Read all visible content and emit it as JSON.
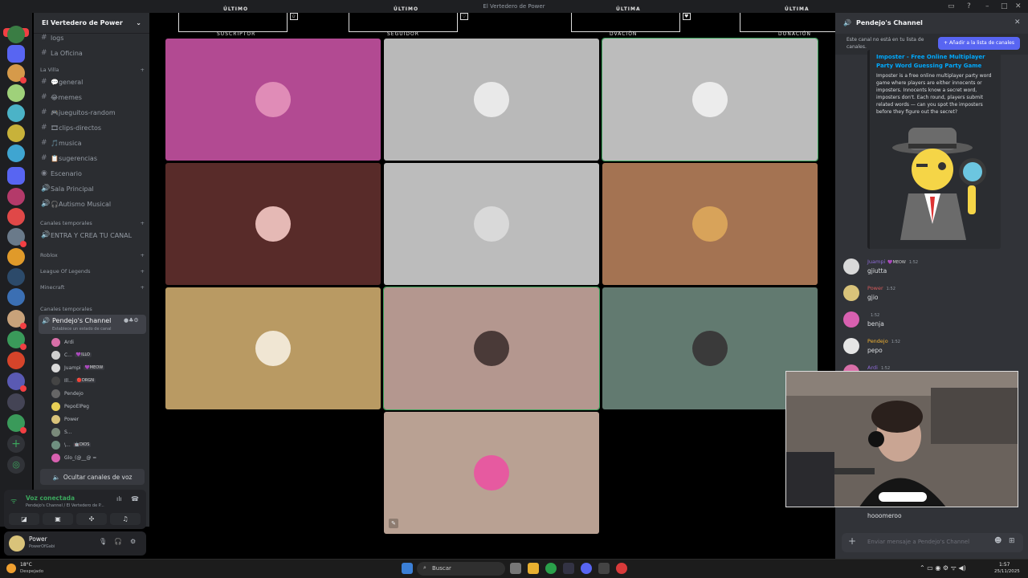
{
  "window": {
    "title": "El Vertedero de Power"
  },
  "rail": {
    "new_badge": "NUEVO"
  },
  "server": {
    "name": "El Vertedero de Power"
  },
  "channels_top": [
    {
      "label": "logs",
      "type": "text"
    },
    {
      "label": "La Oficina",
      "type": "text"
    }
  ],
  "category_villa": "La Villa",
  "channels_villa": [
    {
      "label": "💬general",
      "type": "text"
    },
    {
      "label": "😂memes",
      "type": "text"
    },
    {
      "label": "🎮jueguitos-random",
      "type": "text"
    },
    {
      "label": "🎞clips-directos",
      "type": "text"
    },
    {
      "label": "🎵musica",
      "type": "text"
    },
    {
      "label": "📋sugerencias",
      "type": "text"
    },
    {
      "label": "Escenario",
      "type": "stage"
    },
    {
      "label": "Sala Principal",
      "type": "voice"
    },
    {
      "label": "🎧Autismo Musical",
      "type": "voice"
    }
  ],
  "category_temp": "Canales temporales",
  "channel_create": "ENTRA Y CREA TU CANAL",
  "categories_collapsed": [
    "Roblox",
    "League Of Legends",
    "Minecraft"
  ],
  "category_temp2": "Canales temporales",
  "active_channel": {
    "label": "Pendejo's Channel",
    "status": "Establece un estado de canal"
  },
  "voice_users": [
    {
      "name": "Ardi",
      "tag": "",
      "color": "#d86fa8"
    },
    {
      "name": "C...",
      "tag": "💜ILLO",
      "color": "#cfcfcf"
    },
    {
      "name": "Juampi",
      "tag": "💜MEOW",
      "color": "#d9d9d9"
    },
    {
      "name": "Ill...",
      "tag": "🔴DRGN",
      "color": "#444"
    },
    {
      "name": "Pendejo",
      "tag": "",
      "color": "#666"
    },
    {
      "name": "PepoElPeg",
      "tag": "",
      "color": "#e8cf55"
    },
    {
      "name": "Power",
      "tag": "",
      "color": "#d9c37a"
    },
    {
      "name": "S...",
      "tag": "",
      "color": "#7a8a7a"
    },
    {
      "name": "\\...",
      "tag": "🤖DIOS",
      "color": "#6f8f80"
    },
    {
      "name": "Glo_(@__@ =",
      "tag": "",
      "color": "#d860b0"
    }
  ],
  "hide_voice_label": "Ocultar canales de voz",
  "voice_status": {
    "title": "Voz conectada",
    "subtitle": "Pendejo's Channel / El Vertedero de P..."
  },
  "user": {
    "name": "Power",
    "status": "PowerOfGabi"
  },
  "alerts": [
    {
      "title": "ÚLTIMO",
      "label": "SUSCRIPTOR",
      "icon": "✩"
    },
    {
      "title": "ÚLTIMO",
      "label": "SEGUIDOR",
      "icon": "♡"
    },
    {
      "title": "ÚLTIMA",
      "label": "DVACIÓN",
      "icon": "♥"
    },
    {
      "title": "ÚLTIMA",
      "label": "DONACIÓN",
      "icon": "$"
    }
  ],
  "tiles": [
    {
      "name": "tile-1",
      "bg": "#b24a92",
      "face": "#e08cb7"
    },
    {
      "name": "tile-2",
      "bg": "#b9b9b9",
      "face": "#e9e9e9"
    },
    {
      "name": "tile-3",
      "bg": "#bcbcbc",
      "face": "#ececec"
    },
    {
      "name": "tile-4",
      "bg": "#582b29",
      "face": "#e5b9b5"
    },
    {
      "name": "tile-5",
      "bg": "#bcbcbc",
      "face": "#d9d9d9"
    },
    {
      "name": "tile-6",
      "bg": "#a47352",
      "face": "#d8a35a"
    },
    {
      "name": "tile-7",
      "bg": "#b99a63",
      "face": "#f0e6d3"
    },
    {
      "name": "tile-8",
      "bg": "#b4978f",
      "face": "#4a3a38"
    },
    {
      "name": "tile-9",
      "bg": "#627a70",
      "face": "#3a3a3a"
    },
    {
      "name": "tile-10",
      "bg": "#b9a193",
      "face": "#e65aa0"
    }
  ],
  "chat": {
    "channel_name": "Pendejo's Channel",
    "notice": "Este canal no está en tu lista de canales.",
    "add_button": "+ Añadir a la lista de canales",
    "embed_title": "Imposter - Free Online Multiplayer Party Word Guessing Party Game",
    "embed_desc": "Imposter is a free online multiplayer party word game where players are either innocents or imposters. Innocents know a secret word, imposters don't. Each round, players submit related words — can you spot the imposters before they figure out the secret?",
    "messages": [
      {
        "user": "Juampi",
        "tag": "💜MEOW",
        "time": "1:52",
        "text": "gjiutta",
        "color": "#8e6bd8",
        "av": "#d9d9d9"
      },
      {
        "user": "Power",
        "tag": "",
        "time": "1:52",
        "text": "gjio",
        "color": "#d65a5a",
        "av": "#d9c37a"
      },
      {
        "user": "",
        "tag": "",
        "time": "1:52",
        "text": "benja",
        "color": "#8e6bd8",
        "av": "#d860b0"
      },
      {
        "user": "Pendejo",
        "tag": "",
        "time": "1:52",
        "text": "pepo",
        "color": "#f0b232",
        "av": "#e5e5e5"
      },
      {
        "user": "Ardi",
        "tag": "",
        "time": "1:52",
        "text": "",
        "color": "#8e6bd8",
        "av": "#d86fa8"
      }
    ],
    "last_text": "hooomeroo",
    "input_placeholder": "Enviar mensaje a Pendejo's Channel"
  },
  "taskbar": {
    "temp": "18°C",
    "weather": "Despejado",
    "search_placeholder": "Buscar",
    "time": "1:57",
    "date": "25/11/2025"
  }
}
